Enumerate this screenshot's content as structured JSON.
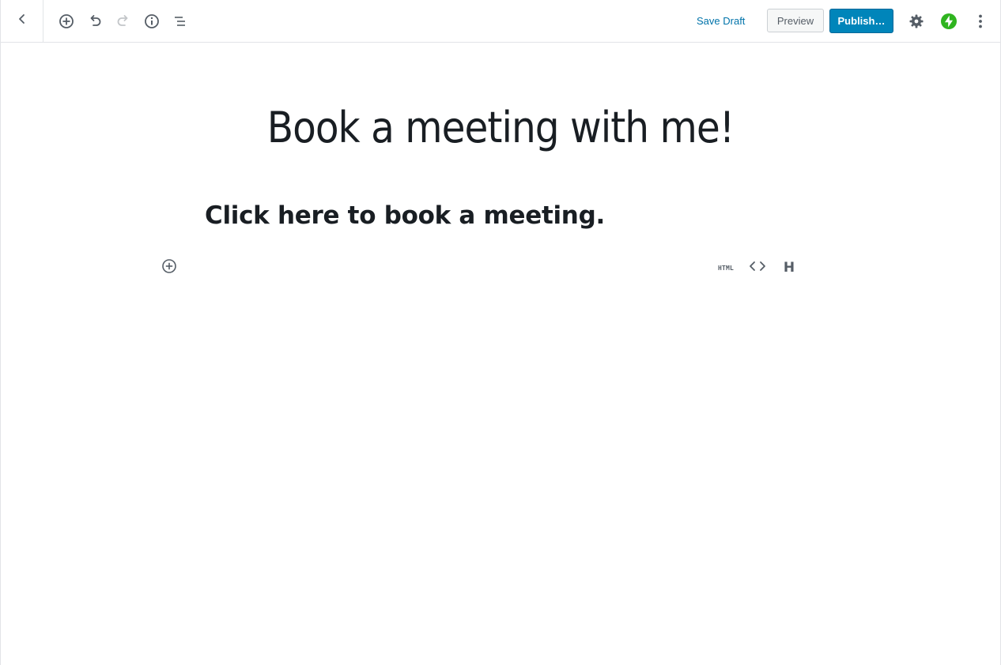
{
  "toolbar": {
    "back_icon": "chevron-left-icon",
    "add_block_icon": "plus-circle-icon",
    "undo_icon": "undo-icon",
    "redo_icon": "redo-icon",
    "info_icon": "info-icon",
    "outline_icon": "list-outline-icon",
    "save_draft_label": "Save Draft",
    "preview_label": "Preview",
    "publish_label": "Publish…",
    "settings_icon": "gear-icon",
    "jetpack_icon": "jetpack-bolt-icon",
    "more_icon": "vertical-ellipsis-icon"
  },
  "post": {
    "title": "Book a meeting with me!",
    "heading": "Click here to book a meeting."
  },
  "block_shortcuts": {
    "html_label": "HTML",
    "code_icon": "code-brackets-icon",
    "heading_label": "H"
  },
  "colors": {
    "accent_link": "#0073aa",
    "publish_bg": "#0085ba",
    "jetpack_green": "#2fb41f",
    "icon_gray": "#555d66"
  }
}
